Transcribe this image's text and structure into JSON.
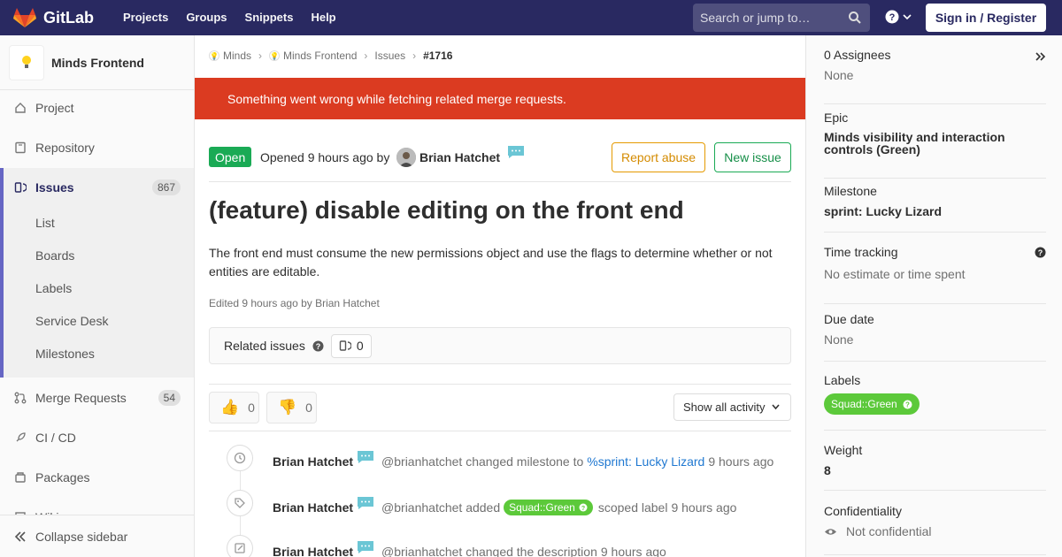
{
  "topnav": {
    "brand": "GitLab",
    "links": [
      "Projects",
      "Groups",
      "Snippets",
      "Help"
    ],
    "search_placeholder": "Search or jump to…",
    "signin": "Sign in / Register"
  },
  "sidebar": {
    "project_name": "Minds Frontend",
    "project": "Project",
    "repository": "Repository",
    "issues": "Issues",
    "issues_count": "867",
    "issues_sub": [
      "List",
      "Boards",
      "Labels",
      "Service Desk",
      "Milestones"
    ],
    "merge_requests": "Merge Requests",
    "mr_count": "54",
    "cicd": "CI / CD",
    "packages": "Packages",
    "wiki": "Wiki",
    "collapse": "Collapse sidebar"
  },
  "breadcrumb": [
    "Minds",
    "Minds Frontend",
    "Issues",
    "#1716"
  ],
  "alert": "Something went wrong while fetching related merge requests.",
  "issue": {
    "status": "Open",
    "opened": "Opened 9 hours ago by",
    "author": "Brian Hatchet",
    "report_abuse": "Report abuse",
    "new_issue": "New issue",
    "title": "(feature) disable editing on the front end",
    "description": "The front end must consume the new permissions object and use the flags to determine whether or not entities are editable.",
    "edited": "Edited 9 hours ago by Brian Hatchet",
    "related_title": "Related issues",
    "related_count": "0",
    "thumbs_up": "0",
    "thumbs_down": "0",
    "activity_filter": "Show all activity"
  },
  "notes": [
    {
      "author": "Brian Hatchet",
      "text1": "@brianhatchet changed milestone to",
      "link": "%sprint: Lucky Lizard",
      "time": "9 hours ago"
    },
    {
      "author": "Brian Hatchet",
      "text1": "@brianhatchet added",
      "label": "Squad::Green",
      "text2": "scoped label",
      "time": "9 hours ago"
    },
    {
      "author": "Brian Hatchet",
      "text1": "@brianhatchet changed the description",
      "time": "9 hours ago"
    }
  ],
  "right": {
    "assignees_label": "0 Assignees",
    "assignees_value": "None",
    "epic_label": "Epic",
    "epic_value": "Minds visibility and interaction controls (Green)",
    "milestone_label": "Milestone",
    "milestone_value": "sprint: Lucky Lizard",
    "time_label": "Time tracking",
    "time_value": "No estimate or time spent",
    "due_label": "Due date",
    "due_value": "None",
    "labels_label": "Labels",
    "label_pill": "Squad::Green",
    "weight_label": "Weight",
    "weight_value": "8",
    "conf_label": "Confidentiality",
    "conf_value": "Not confidential"
  },
  "colors": {
    "nav": "#292961",
    "alert": "#db3b21",
    "open": "#1aaa55",
    "label_green": "#5cc93a",
    "link": "#1f78d1"
  }
}
